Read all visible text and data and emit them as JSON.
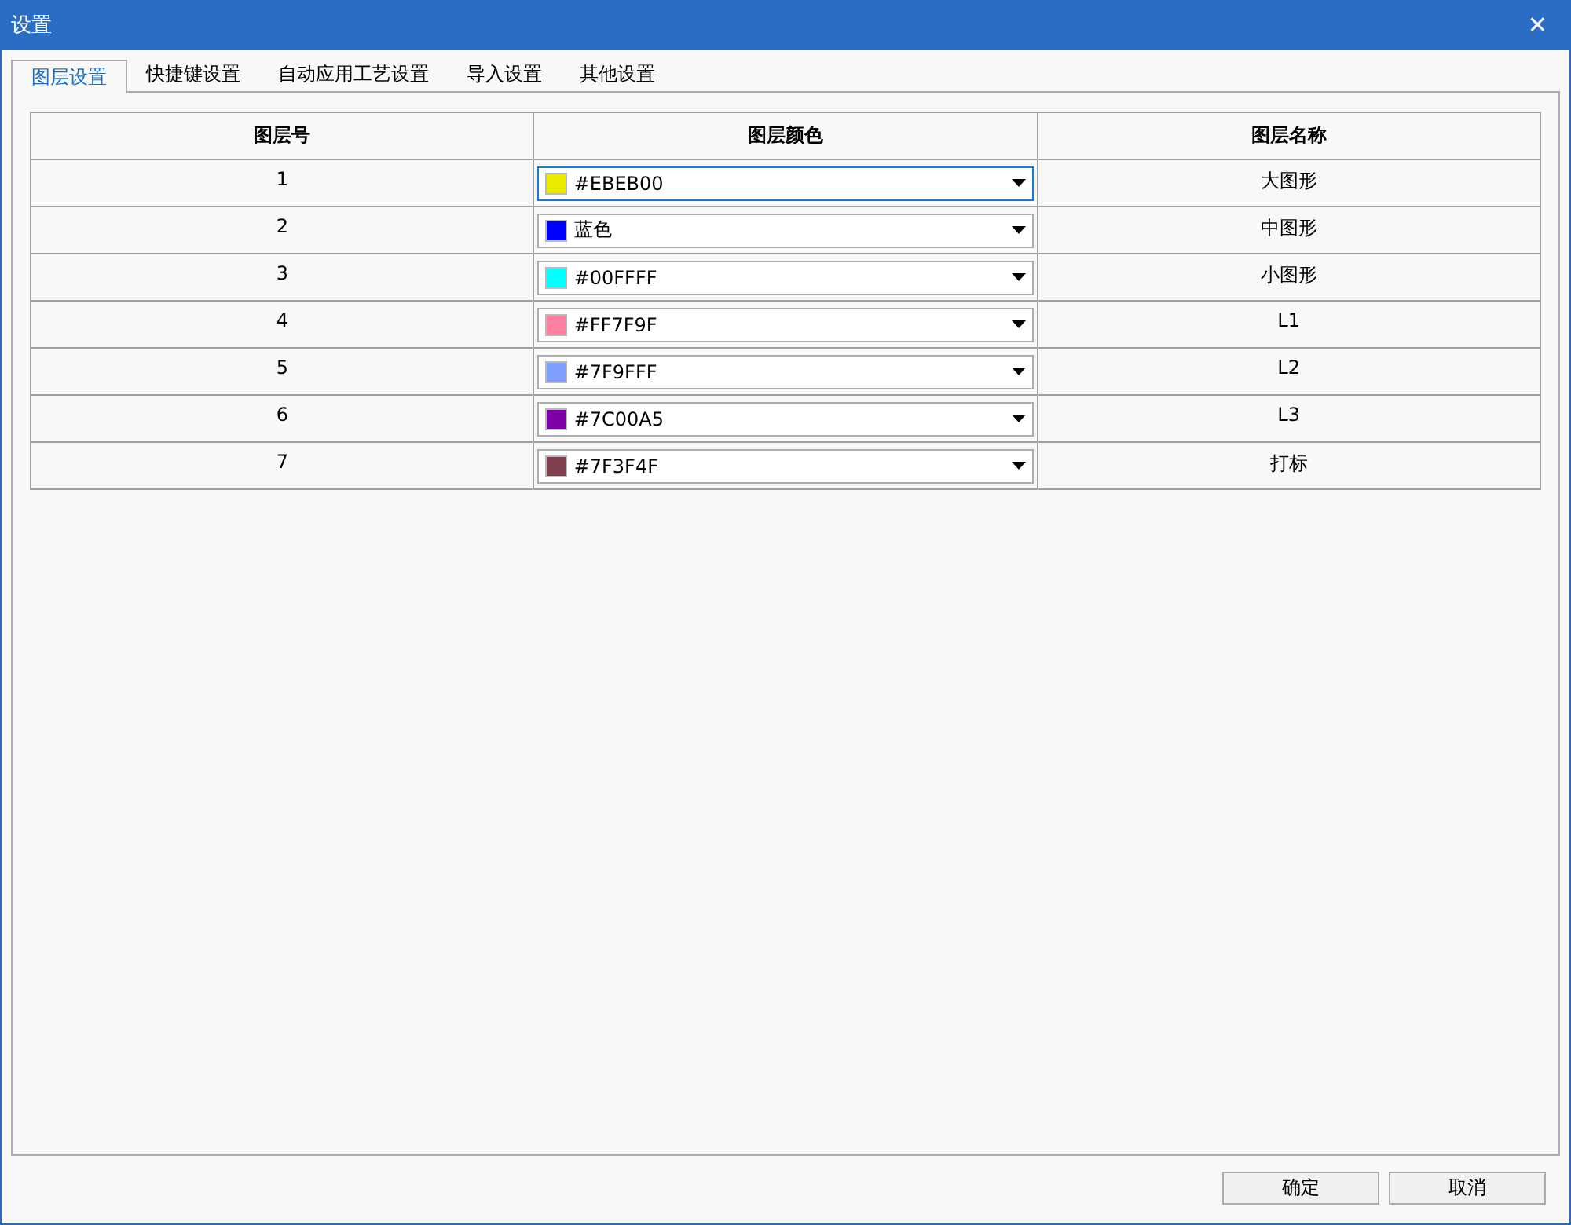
{
  "window": {
    "title": "设置",
    "close": "✕"
  },
  "tabs": [
    {
      "label": "图层设置",
      "selected": true
    },
    {
      "label": "快捷键设置",
      "selected": false
    },
    {
      "label": "自动应用工艺设置",
      "selected": false
    },
    {
      "label": "导入设置",
      "selected": false
    },
    {
      "label": "其他设置",
      "selected": false
    }
  ],
  "table": {
    "columns": [
      "图层号",
      "图层颜色",
      "图层名称"
    ],
    "rows": [
      {
        "number": "1",
        "color_text": "#EBEB00",
        "color": "#ebeb00",
        "focused": true,
        "name": "大图形"
      },
      {
        "number": "2",
        "color_text": "蓝色",
        "color": "#0000ff",
        "focused": false,
        "name": "中图形"
      },
      {
        "number": "3",
        "color_text": "#00FFFF",
        "color": "#00ffff",
        "focused": false,
        "name": "小图形"
      },
      {
        "number": "4",
        "color_text": "#FF7F9F",
        "color": "#ff7f9f",
        "focused": false,
        "name": "L1"
      },
      {
        "number": "5",
        "color_text": "#7F9FFF",
        "color": "#7f9fff",
        "focused": false,
        "name": "L2"
      },
      {
        "number": "6",
        "color_text": "#7C00A5",
        "color": "#7c00a5",
        "focused": false,
        "name": "L3"
      },
      {
        "number": "7",
        "color_text": "#7F3F4F",
        "color": "#7f3f4f",
        "focused": false,
        "name": "打标"
      }
    ]
  },
  "buttons": [
    "确定",
    "取消"
  ]
}
